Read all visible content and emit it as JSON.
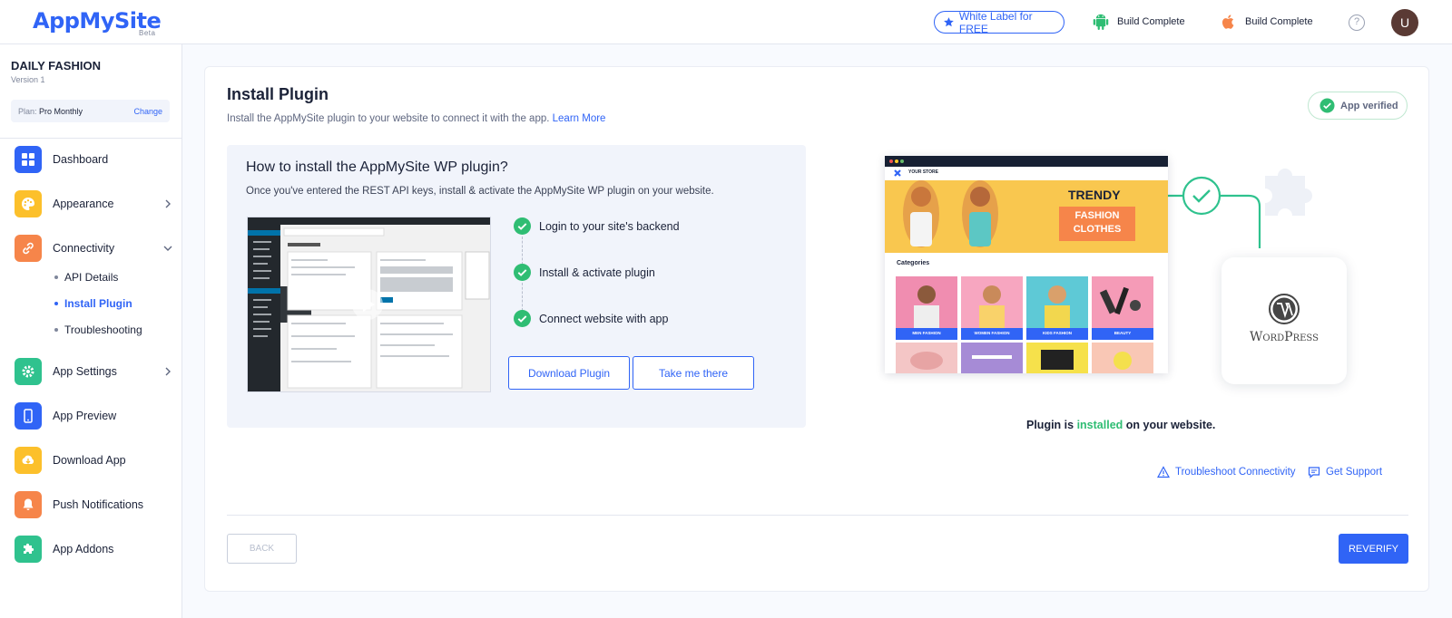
{
  "header": {
    "logo": "AppMySite",
    "logo_badge": "Beta",
    "white_label": "White Label for FREE",
    "android_status": "Build Complete",
    "ios_status": "Build Complete",
    "help_icon": "question-icon",
    "avatar_initial": "U"
  },
  "sidebar": {
    "app_name": "DAILY FASHION",
    "version": "Version 1",
    "plan_key": "Plan:",
    "plan_value": "Pro Monthly",
    "change_label": "Change",
    "items": [
      {
        "label": "Dashboard",
        "icon": "dashboard-icon",
        "color": "#3064f6"
      },
      {
        "label": "Appearance",
        "icon": "palette-icon",
        "color": "#fcc02b"
      },
      {
        "label": "Connectivity",
        "icon": "link-icon",
        "color": "#f6854a"
      },
      {
        "label": "App Settings",
        "icon": "gear-icon",
        "color": "#2fc28e"
      },
      {
        "label": "App Preview",
        "icon": "phone-icon",
        "color": "#3064f6"
      },
      {
        "label": "Download App",
        "icon": "cloud-download-icon",
        "color": "#fcc02b"
      },
      {
        "label": "Push Notifications",
        "icon": "bell-icon",
        "color": "#f6854a"
      },
      {
        "label": "App Addons",
        "icon": "puzzle-icon",
        "color": "#2fc28e"
      }
    ],
    "sub_items": [
      "API Details",
      "Install Plugin",
      "Troubleshooting"
    ]
  },
  "main": {
    "title": "Install Plugin",
    "subtitle": "Install the AppMySite plugin to your website to connect it with the app.",
    "learn_more": "Learn More",
    "verified_label": "App verified",
    "how_title": "How to install the AppMySite WP plugin?",
    "how_desc": "Once you've entered the REST API keys, install & activate the AppMySite WP plugin on your website.",
    "steps": [
      "Login to your site's backend",
      "Install & activate plugin",
      "Connect website with app"
    ],
    "download_btn": "Download Plugin",
    "take_me_btn": "Take me there",
    "store": {
      "brand": "YOUR STORE",
      "banner_word": "TRENDY",
      "banner_tag_1": "FASHION",
      "banner_tag_2": "CLOTHES",
      "categories_title": "Categories",
      "categories": [
        "MEN FASHION",
        "WOMEN FASHION",
        "KIDS FASHION",
        "BEAUTY"
      ]
    },
    "wp_label": "WordPress",
    "status_prefix": "Plugin is",
    "status_highlight": "installed",
    "status_suffix": "on your website.",
    "troubleshoot_link": "Troubleshoot Connectivity",
    "support_link": "Get Support",
    "back_btn": "BACK",
    "reverify_btn": "REVERIFY"
  },
  "colors": {
    "accent": "#3064f6",
    "success": "#2fbd73",
    "banner": "#f9c74f",
    "tag": "#f6854a"
  }
}
